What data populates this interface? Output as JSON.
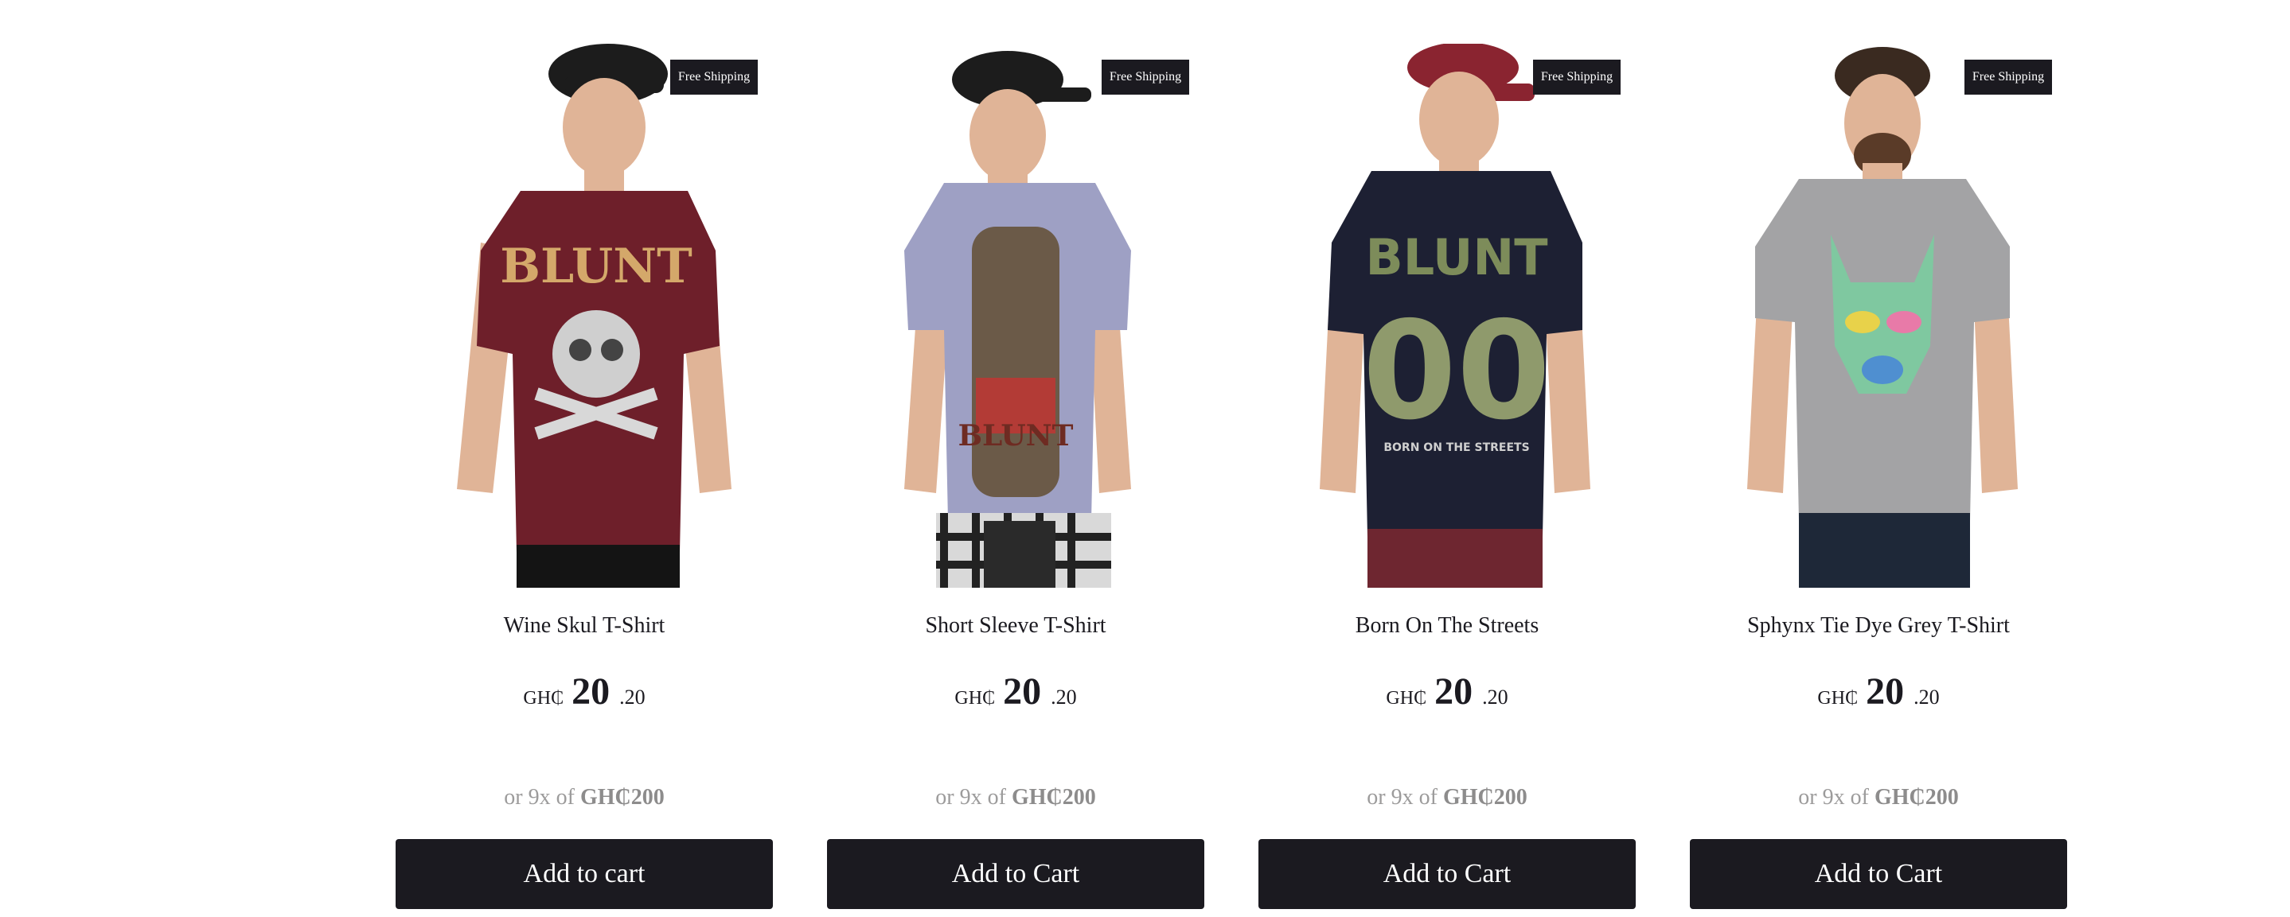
{
  "products": [
    {
      "name": "Wine Skul T-Shirt",
      "badge": "Free Shipping",
      "currency": "GH₵",
      "price_whole": "20",
      "price_cents": ".20",
      "installment_prefix": "or 9x of",
      "installment_amount": "GH₵200",
      "button_label": "Add to cart",
      "shirt_color": "#6e1f2a",
      "cap_color": "#1c1c1c",
      "pants_color": "#141414",
      "print_icon": "skull-print-icon"
    },
    {
      "name": "Short Sleeve T-Shirt",
      "badge": "Free Shipping",
      "currency": "GH₵",
      "price_whole": "20",
      "price_cents": ".20",
      "installment_prefix": "or 9x of",
      "installment_amount": "GH₵200",
      "button_label": "Add to Cart",
      "shirt_color": "#9ea0c4",
      "cap_color": "#1c1c1c",
      "pants_color": "#2a2a2a",
      "print_icon": "warrior-print-icon"
    },
    {
      "name": "Born On The Streets",
      "badge": "Free Shipping",
      "currency": "GH₵",
      "price_whole": "20",
      "price_cents": ".20",
      "installment_prefix": "or 9x of",
      "installment_amount": "GH₵200",
      "button_label": "Add to Cart",
      "shirt_color": "#1d2033",
      "cap_color": "#8a2430",
      "pants_color": "#6e2630",
      "print_icon": "floral-00-print-icon"
    },
    {
      "name": "Sphynx Tie Dye Grey T-Shirt",
      "badge": "Free Shipping",
      "currency": "GH₵",
      "price_whole": "20",
      "price_cents": ".20",
      "installment_prefix": "or 9x of",
      "installment_amount": "GH₵200",
      "button_label": "Add to Cart",
      "shirt_color": "#a3a3a5",
      "cap_color": "#3a2a20",
      "pants_color": "#1e2838",
      "print_icon": "tie-dye-cat-print-icon"
    }
  ],
  "colors": {
    "button_bg": "#1b1a20",
    "button_text": "#ffffff",
    "badge_bg": "#1b1a20",
    "muted_text": "#9c9b9b",
    "skin": "#e0b497"
  }
}
